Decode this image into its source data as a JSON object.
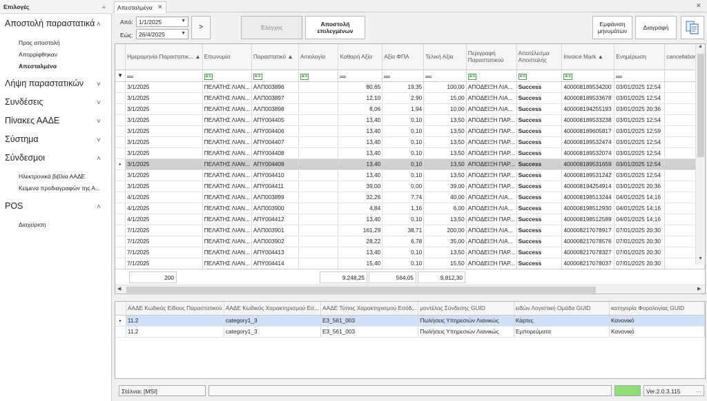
{
  "nav": {
    "title": "Επιλογές",
    "groups": [
      {
        "label": "Αποστολή παραστατικά",
        "expanded": true,
        "items": [
          {
            "label": "Προς αποστολή",
            "active": false
          },
          {
            "label": "Απορρίφθηκαν",
            "active": false
          },
          {
            "label": "Απεσταλμένα",
            "active": true
          }
        ]
      },
      {
        "label": "Λήψη παραστατικών",
        "expanded": false,
        "items": []
      },
      {
        "label": "Συνδέσεις",
        "expanded": false,
        "items": []
      },
      {
        "label": "Πίνακες ΑΑΔΕ",
        "expanded": false,
        "items": []
      },
      {
        "label": "Σύστημα",
        "expanded": false,
        "items": []
      },
      {
        "label": "Σύνδεσμοι",
        "expanded": true,
        "items": [
          {
            "label": "Ηλεκτρονικά βιβλία ΑΑΔΕ",
            "active": false
          },
          {
            "label": "Κείμενα προδιαγραφών της Α...",
            "active": false
          }
        ]
      },
      {
        "label": "POS",
        "expanded": true,
        "items": [
          {
            "label": "Διαχείριση",
            "active": false
          }
        ]
      }
    ]
  },
  "tab": {
    "label": "Απεσταλμένα"
  },
  "toolbar": {
    "from_label": "Από:",
    "from_value": "1/1/2025",
    "to_label": "Εώς:",
    "to_value": "26/4/2025",
    "go_label": ">",
    "check_label": "Έλεγχος",
    "send_selected_line1": "Αποστολή",
    "send_selected_line2": "επιλεγμένων",
    "show_messages_line1": "Εμφάνιση",
    "show_messages_line2": "μηνυμάτων",
    "delete_label": "Διαγραφή"
  },
  "grid": {
    "columns": [
      "Ημερομηνία Παραστατικ...",
      "Επωνυμία",
      "Παραστατικό",
      "Αιτιολογία",
      "Καθαρή Αξία",
      "Αξία ΦΠΑ",
      "Τελική Αξία",
      "Περιγραφή Παραστατικού",
      "Αποτέλεσμα Αποστολής",
      "Invoice Mark",
      "Ενημέρωση",
      "cancellation f"
    ],
    "rows": [
      [
        "3/1/2025",
        "ΠΕΛΑΤΗΣ ΛΙΑΝ...",
        "ΑΛΠ003896",
        "",
        "80,65",
        "19,35",
        "100,00",
        "ΑΠΟΔΕΙΞΗ ΛΙΑ...",
        "Success",
        "400008189534200",
        "03/01/2025 12:54",
        ""
      ],
      [
        "3/1/2025",
        "ΠΕΛΑΤΗΣ ΛΙΑΝ...",
        "ΑΛΠ003897",
        "",
        "12,10",
        "2,90",
        "15,00",
        "ΑΠΟΔΕΙΞΗ ΛΙΑ...",
        "Success",
        "400008189533678",
        "03/01/2025 12:54",
        ""
      ],
      [
        "3/1/2025",
        "ΠΕΛΑΤΗΣ ΛΙΑΝ...",
        "ΑΛΠ003898",
        "",
        "8,06",
        "1,94",
        "10,00",
        "ΑΠΟΔΕΙΞΗ ΛΙΑ...",
        "Success",
        "400008194255193",
        "03/01/2025 20:36",
        ""
      ],
      [
        "3/1/2025",
        "ΠΕΛΑΤΗΣ ΛΙΑΝ...",
        "ΑΠΥ004405",
        "",
        "13,40",
        "0,10",
        "13,50",
        "ΑΠΟΔΕΙΞΗ ΠΑΡ...",
        "Success",
        "400008189533238",
        "03/01/2025 12:54",
        ""
      ],
      [
        "3/1/2025",
        "ΠΕΛΑΤΗΣ ΛΙΑΝ...",
        "ΑΠΥ004406",
        "",
        "13,40",
        "0,10",
        "13,50",
        "ΑΠΟΔΕΙΞΗ ΠΑΡ...",
        "Success",
        "400008189605817",
        "03/01/2025 12:59",
        ""
      ],
      [
        "3/1/2025",
        "ΠΕΛΑΤΗΣ ΛΙΑΝ...",
        "ΑΠΥ004407",
        "",
        "13,40",
        "0,10",
        "13,50",
        "ΑΠΟΔΕΙΞΗ ΠΑΡ...",
        "Success",
        "400008189532474",
        "03/01/2025 12:54",
        ""
      ],
      [
        "3/1/2025",
        "ΠΕΛΑΤΗΣ ΛΙΑΝ...",
        "ΑΠΥ004408",
        "",
        "13,40",
        "0,10",
        "13,50",
        "ΑΠΟΔΕΙΞΗ ΠΑΡ...",
        "Success",
        "400008189532074",
        "03/01/2025 12:54",
        ""
      ],
      [
        "3/1/2025",
        "ΠΕΛΑΤΗΣ ΛΙΑΝ...",
        "ΑΠΥ004409",
        "",
        "13,40",
        "0,10",
        "13,50",
        "ΑΠΟΔΕΙΞΗ ΠΑΡ...",
        "Success",
        "400008189531659",
        "03/01/2025 12:54",
        ""
      ],
      [
        "3/1/2025",
        "ΠΕΛΑΤΗΣ ΛΙΑΝ...",
        "ΑΠΥ004410",
        "",
        "13,40",
        "0,10",
        "13,50",
        "ΑΠΟΔΕΙΞΗ ΠΑΡ...",
        "Success",
        "400008189531242",
        "03/01/2025 12:54",
        ""
      ],
      [
        "3/1/2025",
        "ΠΕΛΑΤΗΣ ΛΙΑΝ...",
        "ΑΠΥ004411",
        "",
        "39,00",
        "0,00",
        "39,00",
        "ΑΠΟΔΕΙΞΗ ΠΑΡ...",
        "Success",
        "400008194254914",
        "03/01/2025 20:36",
        ""
      ],
      [
        "4/1/2025",
        "ΠΕΛΑΤΗΣ ΛΙΑΝ...",
        "ΑΛΠ003899",
        "",
        "32,26",
        "7,74",
        "40,00",
        "ΑΠΟΔΕΙΞΗ ΛΙΑ...",
        "Success",
        "400008198513244",
        "04/01/2025 14:16",
        ""
      ],
      [
        "4/1/2025",
        "ΠΕΛΑΤΗΣ ΛΙΑΝ...",
        "ΑΛΠ003900",
        "",
        "4,84",
        "1,16",
        "6,00",
        "ΑΠΟΔΕΙΞΗ ΛΙΑ...",
        "Success",
        "400008198512930",
        "04/01/2025 14:16",
        ""
      ],
      [
        "4/1/2025",
        "ΠΕΛΑΤΗΣ ΛΙΑΝ...",
        "ΑΠΥ004412",
        "",
        "13,40",
        "0,10",
        "13,50",
        "ΑΠΟΔΕΙΞΗ ΠΑΡ...",
        "Success",
        "400008198512589",
        "04/01/2025 14:16",
        ""
      ],
      [
        "7/1/2025",
        "ΠΕΛΑΤΗΣ ΛΙΑΝ...",
        "ΑΛΠ003901",
        "",
        "161,29",
        "38,71",
        "200,00",
        "ΑΠΟΔΕΙΞΗ ΛΙΑ...",
        "Success",
        "400008217078917",
        "07/01/2025 20:30",
        ""
      ],
      [
        "7/1/2025",
        "ΠΕΛΑΤΗΣ ΛΙΑΝ...",
        "ΑΛΠ003902",
        "",
        "28,22",
        "6,78",
        "35,00",
        "ΑΠΟΔΕΙΞΗ ΛΙΑ...",
        "Success",
        "400008217078576",
        "07/01/2025 20:30",
        ""
      ],
      [
        "7/1/2025",
        "ΠΕΛΑΤΗΣ ΛΙΑΝ...",
        "ΑΠΥ004413",
        "",
        "13,40",
        "0,10",
        "13,50",
        "ΑΠΟΔΕΙΞΗ ΠΑΡ...",
        "Success",
        "400008217078327",
        "07/01/2025 20:30",
        ""
      ],
      [
        "7/1/2025",
        "ΠΕΛΑΤΗΣ ΛΙΑΝ...",
        "ΑΠΥ004414",
        "",
        "15,40",
        "0,10",
        "15,50",
        "ΑΠΟΔΕΙΞΗ ΠΑΡ...",
        "Success",
        "400008217078037",
        "07/01/2025 20:30",
        ""
      ]
    ],
    "selected_row": 7,
    "summary": {
      "count": "200",
      "net": "9.248,25",
      "vat": "564,05",
      "total": "9.812,30"
    }
  },
  "detail": {
    "columns": [
      "ΑΑΔΕ Κωδικός Είδους Παραστατικού",
      "ΑΑΔΕ Κωδικός Χαρακτηρισμού Εσ...",
      "ΑΑΔΕ Τύπος Χαρακτηρισμού Εσόδ...",
      "μοντέλος Σύνδεσης GUID",
      "ειδών Λογιστική Ομάδα GUID",
      "κατηγορία Φορολογίας GUID"
    ],
    "rows": [
      [
        "11.2",
        "category1_3",
        "E3_561_003",
        "Πωλήσεις Υπηρεσιών Λιανικώς",
        "Κάρτες",
        "Κανονικό"
      ],
      [
        "11.2",
        "category1_3",
        "E3_561_003",
        "Πωλήσεις Υπηρεσιών Λιανικώς",
        "Εμπορεύματα",
        "Κανονικό"
      ]
    ],
    "selected_row": 0
  },
  "status": {
    "station": "Στέλναι: [MSI]",
    "progress": "",
    "indicator_color": "#8fdc7a",
    "version": "Ver.2.0.3.115"
  }
}
